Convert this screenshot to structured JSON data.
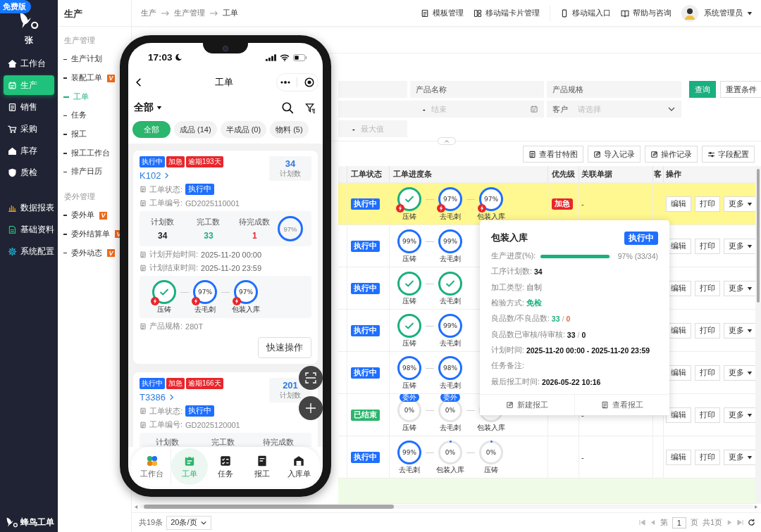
{
  "sidebar": {
    "edition_badge": "免费版",
    "user": "张",
    "items": [
      {
        "label": "工作台",
        "selected": false
      },
      {
        "label": "生产",
        "selected": true
      },
      {
        "label": "销售",
        "selected": false
      },
      {
        "label": "采购",
        "selected": false
      },
      {
        "label": "库存",
        "selected": false
      },
      {
        "label": "质检",
        "selected": false
      }
    ],
    "extra_items": [
      {
        "label": "数据报表",
        "selected": false
      },
      {
        "label": "基础资料",
        "selected": false
      },
      {
        "label": "系统配置",
        "selected": false
      }
    ],
    "brand": "蜂鸟工单"
  },
  "subnav": {
    "title": "生产",
    "groups": [
      {
        "title": "生产管理",
        "items": [
          {
            "label": "生产计划",
            "selected": false
          },
          {
            "label": "装配工单",
            "badge": "V",
            "selected": false
          },
          {
            "label": "工单",
            "selected": true
          },
          {
            "label": "任务",
            "selected": false
          },
          {
            "label": "报工",
            "selected": false
          },
          {
            "label": "报工工作台",
            "selected": false
          },
          {
            "label": "排产日历",
            "selected": false
          }
        ]
      },
      {
        "title": "委外管理",
        "items": [
          {
            "label": "委外单",
            "badge": "V",
            "selected": false
          },
          {
            "label": "委外结算单",
            "badge": "V",
            "selected": false
          },
          {
            "label": "委外动态",
            "badge": "V",
            "selected": false
          }
        ]
      }
    ]
  },
  "topbar": {
    "breadcrumb": [
      "生产",
      "生产管理",
      "工单"
    ],
    "links": [
      "模板管理",
      "移动端卡片管理",
      "移动端入口",
      "帮助与咨询"
    ],
    "user": "系统管理员"
  },
  "filters": {
    "product_name": {
      "label": "产品名称"
    },
    "product_spec": {
      "label": "产品规格"
    },
    "date_range": {
      "separator": "-",
      "placeholder": "结束"
    },
    "customer": {
      "label": "客户",
      "placeholder": "请选择"
    },
    "value_range": {
      "separator": "-",
      "placeholder": "最大值"
    },
    "buttons": [
      "查询",
      "重置条件"
    ]
  },
  "toolbar": [
    "查看甘特图",
    "导入记录",
    "操作记录",
    "字段配置"
  ],
  "table": {
    "columns": [
      "工单状态",
      "工单进度条",
      "优先级",
      "关联单据",
      "客",
      "操作"
    ],
    "rows": [
      {
        "selected": true,
        "status": "执行中",
        "finished": false,
        "steps": [
          {
            "label": "压铸",
            "kind": "done",
            "alert": true
          },
          {
            "label": "去毛刺",
            "kind": "progress",
            "percent": "97%",
            "alert": true
          },
          {
            "label": "包装入库",
            "kind": "progress",
            "percent": "97%",
            "alert": true
          }
        ],
        "priority": "加急",
        "related": "-",
        "actions": [
          "编辑",
          "打印",
          "更多"
        ]
      },
      {
        "selected": false,
        "status": "执行中",
        "finished": false,
        "steps": [
          {
            "label": "压铸",
            "kind": "progress",
            "percent": "99%",
            "alert": false
          },
          {
            "label": "去毛刺",
            "kind": "progress",
            "percent": "99%",
            "alert": false
          }
        ],
        "actions": [
          "编辑",
          "打印",
          "更多"
        ]
      },
      {
        "selected": false,
        "status": "执行中",
        "finished": false,
        "steps": [
          {
            "label": "压铸",
            "kind": "done",
            "alert": false
          },
          {
            "label": "去毛刺",
            "kind": "done",
            "alert": false
          }
        ],
        "actions": [
          "编辑",
          "打印",
          "更多"
        ]
      },
      {
        "selected": false,
        "status": "执行中",
        "finished": false,
        "steps": [
          {
            "label": "压铸",
            "kind": "done",
            "alert": false
          },
          {
            "label": "去毛刺",
            "kind": "progress",
            "percent": "99%",
            "alert": false
          }
        ],
        "actions": [
          "编辑",
          "打印",
          "更多"
        ]
      },
      {
        "selected": false,
        "status": "执行中",
        "finished": false,
        "steps": [
          {
            "label": "压铸",
            "kind": "progress",
            "percent": "98%",
            "alert": false
          },
          {
            "label": "去毛刺",
            "kind": "progress",
            "percent": "98%",
            "alert": false
          }
        ],
        "actions": [
          "编辑",
          "打印",
          "更多"
        ]
      },
      {
        "selected": false,
        "status": "已结束",
        "finished": true,
        "steps": [
          {
            "label": "压铸",
            "kind": "pending",
            "percent": "0%",
            "tag": "委外",
            "alert": false
          },
          {
            "label": "去毛刺",
            "kind": "pending",
            "percent": "0%",
            "tag": "委外",
            "alert": false
          },
          {
            "label": "包装入库",
            "kind": "pending",
            "alert": false
          }
        ],
        "related": "-",
        "actions": [
          "编辑",
          "打印",
          "更多"
        ]
      },
      {
        "selected": false,
        "status": "执行中",
        "finished": false,
        "steps": [
          {
            "label": "去毛刺",
            "kind": "progress",
            "percent": "99%",
            "alert": false
          },
          {
            "label": "包装入库",
            "kind": "pending",
            "percent": "0%",
            "alert": false
          },
          {
            "label": "压铸",
            "kind": "pending",
            "percent": "0%",
            "alert": false
          }
        ],
        "related": "-",
        "actions": [
          "编辑",
          "打印",
          "更多"
        ]
      }
    ]
  },
  "popup": {
    "title": "包装入库",
    "status": "执行中",
    "progress": {
      "label": "生产进度(%):",
      "level": 0.97,
      "percent": "97%",
      "ratio": "(33/34)"
    },
    "fields": [
      {
        "label": "工序计划数:",
        "parts": [
          {
            "text": "34",
            "kind": "strong"
          }
        ]
      },
      {
        "label": "加工类型:",
        "parts": [
          {
            "text": "自制",
            "kind": "plain"
          }
        ]
      },
      {
        "label": "检验方式:",
        "parts": [
          {
            "text": "免检",
            "kind": "good"
          }
        ]
      },
      {
        "label": "良品数/不良品数:",
        "parts": [
          {
            "text": "33",
            "kind": "good"
          },
          {
            "text": "/",
            "kind": "muted"
          },
          {
            "text": "0",
            "kind": "bad"
          }
        ]
      },
      {
        "label": "良品数已审核/待审核:",
        "parts": [
          {
            "text": "33",
            "kind": "strong"
          },
          {
            "text": "/",
            "kind": "muted"
          },
          {
            "text": "0",
            "kind": "strong"
          }
        ]
      },
      {
        "label": "计划时间:",
        "parts": [
          {
            "text": "2025-11-20 00:00 - 2025-11-20 23:59",
            "kind": "strong"
          }
        ]
      },
      {
        "label": "任务备注:"
      },
      {
        "label": "最后报工时间:",
        "parts": [
          {
            "text": "2026-05-22 10:16",
            "kind": "strong"
          }
        ]
      }
    ],
    "actions": [
      "新建报工",
      "查看报工"
    ]
  },
  "pager": {
    "total": "共19条",
    "page_size": "20条/页",
    "page_prefix": "第",
    "page": "1",
    "page_suffix": "页",
    "page_count": "共1页"
  },
  "phone": {
    "time": "17:03",
    "title": "工单",
    "scope": "全部",
    "chips": [
      {
        "label": "全部",
        "selected": true
      },
      {
        "label": "成品 (14)",
        "selected": false
      },
      {
        "label": "半成品 (0)",
        "selected": false
      },
      {
        "label": "物料 (5)",
        "selected": false
      }
    ],
    "cards": [
      {
        "tags": [
          {
            "text": "执行中",
            "color": "#1f6fff"
          },
          {
            "text": "加急",
            "color": "#e8262b"
          },
          {
            "text": "逾期193天",
            "color": "#e8262b"
          }
        ],
        "code": "K102",
        "plan": "34",
        "plan_label": "计划数",
        "status_label": "工单状态:",
        "status": "执行中",
        "number_label": "工单编号:",
        "number": "GD2025110001",
        "stats": [
          {
            "label": "计划数",
            "value": "34",
            "color": "#222222"
          },
          {
            "label": "完工数",
            "value": "33",
            "color": "#1aaf7f"
          },
          {
            "label": "待完成数",
            "value": "1",
            "color": "#e8262b"
          }
        ],
        "ring": "97%",
        "dates": [
          {
            "label": "计划开始时间:",
            "value": "2025-11-20 00:00"
          },
          {
            "label": "计划结束时间:",
            "value": "2025-11-20 23:59"
          }
        ],
        "steps": [
          {
            "label": "压铸",
            "kind": "done",
            "alert": true
          },
          {
            "label": "去毛刺",
            "kind": "progress",
            "percent": "97%",
            "alert": true
          },
          {
            "label": "包装入库",
            "kind": "progress",
            "percent": "97%",
            "alert": true
          }
        ],
        "spec_label": "产品规格:",
        "spec": "280T",
        "action": "快速操作"
      },
      {
        "tags": [
          {
            "text": "执行中",
            "color": "#1f6fff"
          },
          {
            "text": "加急",
            "color": "#e8262b"
          },
          {
            "text": "逾期166天",
            "color": "#e8262b"
          }
        ],
        "code": "T3386",
        "plan": "201",
        "plan_label": "计划数",
        "status_label": "工单状态:",
        "status": "执行中",
        "number_label": "工单编号:",
        "number": "GD2025120001",
        "stats": [
          {
            "label": "计划数"
          },
          {
            "label": "完工数"
          },
          {
            "label": "待完成数"
          }
        ]
      }
    ],
    "tabs": [
      {
        "label": "工作台",
        "selected": false
      },
      {
        "label": "工单",
        "selected": true
      },
      {
        "label": "任务",
        "selected": false
      },
      {
        "label": "报工",
        "selected": false
      },
      {
        "label": "入库单",
        "selected": false
      }
    ]
  }
}
